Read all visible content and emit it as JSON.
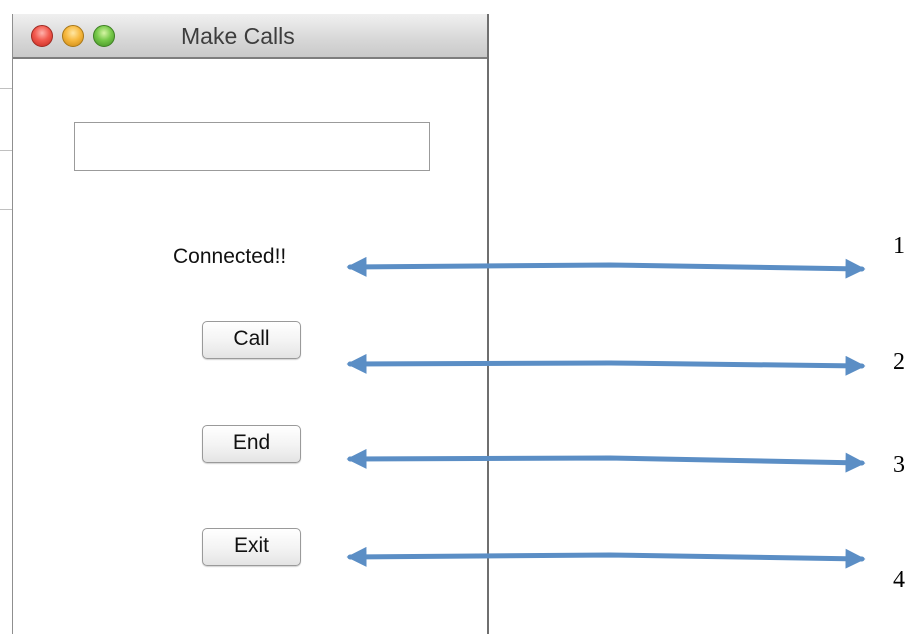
{
  "window": {
    "title": "Make Calls"
  },
  "form": {
    "input_value": "",
    "status_text": "Connected!!",
    "call_label": "Call",
    "end_label": "End",
    "exit_label": "Exit"
  },
  "callouts": [
    "1",
    "2",
    "3",
    "4"
  ],
  "colors": {
    "arrow": "#5b8ec5",
    "close": "#f25a4f",
    "minimize": "#f7b940",
    "zoom": "#77c94a"
  }
}
